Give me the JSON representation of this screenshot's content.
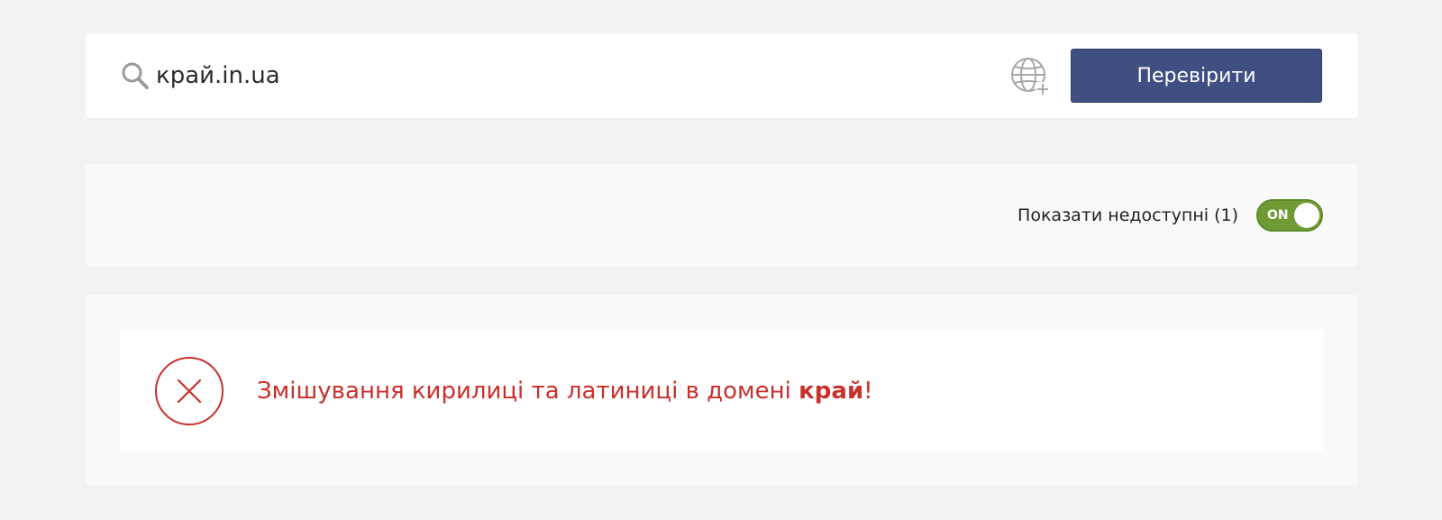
{
  "search": {
    "value": "край.in.ua",
    "button_label": "Перевірити",
    "icon": "search-icon",
    "idn_icon": "globe-plus-icon"
  },
  "filter": {
    "label": "Показати недоступні (1)",
    "toggle_state": "ON"
  },
  "result": {
    "status": "error",
    "icon": "close-circle-icon",
    "message_prefix": "Змішування кирилиці та латиниці в домені ",
    "message_highlight": "край",
    "message_suffix": "!"
  },
  "colors": {
    "primary_button": "#3f4f82",
    "toggle_on": "#6e9b34",
    "error": "#c8302c",
    "background": "#f2f2f2"
  }
}
